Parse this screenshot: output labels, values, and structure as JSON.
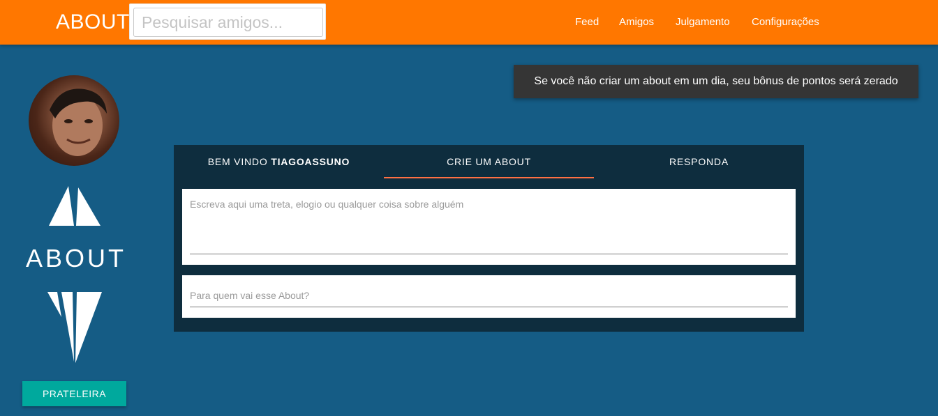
{
  "header": {
    "brand": "ABOUT",
    "search_placeholder": "Pesquisar amigos...",
    "nav": [
      "Feed",
      "Amigos",
      "Julgamento",
      "Configurações"
    ]
  },
  "notice": "Se você não criar um about em um dia, seu bônus de pontos será zerado",
  "sidebar": {
    "logo_text": "ABOUT",
    "button": "PRATELEIRA"
  },
  "tabs": {
    "welcome_prefix": "BEM VINDO ",
    "username": "TIAGOASSUNO",
    "create": "CRIE UM ABOUT",
    "reply": "RESPONDA"
  },
  "form": {
    "about_placeholder": "Escreva aqui uma treta, elogio ou qualquer coisa sobre alguém",
    "recipient_placeholder": "Para quem vai esse About?"
  },
  "colors": {
    "header": "#ff7700",
    "background": "#155c85",
    "card": "#0e2d3e",
    "accent_tab": "#ff7043",
    "button": "#00a99d"
  },
  "icons": [
    "avatar-photo",
    "about-logo-triangle",
    "about-logo-shards"
  ]
}
